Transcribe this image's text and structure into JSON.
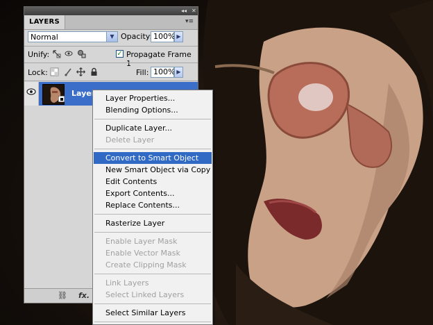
{
  "panel": {
    "tab": "LAYERS",
    "blend_mode": "Normal",
    "opacity_label": "Opacity:",
    "opacity_value": "100%",
    "unify_label": "Unify:",
    "propagate_label": "Propagate Frame 1",
    "propagate_checked": true,
    "lock_label": "Lock:",
    "fill_label": "Fill:",
    "fill_value": "100%",
    "layer_name": "Layer"
  },
  "menu": {
    "items": [
      {
        "label": "Layer Properties...",
        "enabled": true
      },
      {
        "label": "Blending Options...",
        "enabled": true
      },
      {
        "label": "Duplicate Layer...",
        "enabled": true
      },
      {
        "label": "Delete Layer",
        "enabled": false
      },
      {
        "label": "Convert to Smart Object",
        "enabled": true,
        "highlighted": true
      },
      {
        "label": "New Smart Object via Copy",
        "enabled": true
      },
      {
        "label": "Edit Contents",
        "enabled": true
      },
      {
        "label": "Export Contents...",
        "enabled": true
      },
      {
        "label": "Replace Contents...",
        "enabled": true
      },
      {
        "label": "Rasterize Layer",
        "enabled": true
      },
      {
        "label": "Enable Layer Mask",
        "enabled": false
      },
      {
        "label": "Enable Vector Mask",
        "enabled": false
      },
      {
        "label": "Create Clipping Mask",
        "enabled": false
      },
      {
        "label": "Link Layers",
        "enabled": false
      },
      {
        "label": "Select Linked Layers",
        "enabled": false
      },
      {
        "label": "Select Similar Layers",
        "enabled": true
      }
    ]
  },
  "colors": {
    "highlight": "#316ac5",
    "selected_layer": "#3a6ec8",
    "panel_bg": "#d6d6d6"
  }
}
